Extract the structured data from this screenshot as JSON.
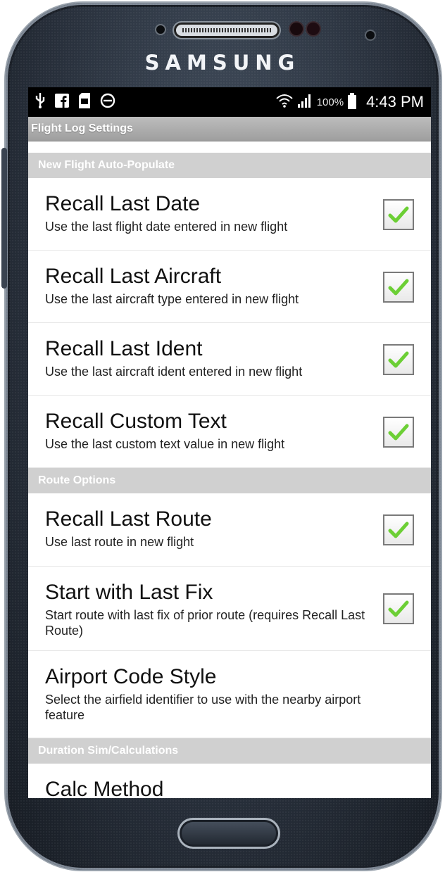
{
  "device": {
    "brand": "SAMSUNG"
  },
  "statusbar": {
    "left_icons": [
      "usb-icon",
      "facebook-icon",
      "sd-card-icon",
      "do-not-disturb-icon"
    ],
    "battery_percent": "100%",
    "time": "4:43 PM"
  },
  "app": {
    "title": "Flight Log Settings"
  },
  "sections": [
    {
      "header": "New Flight Auto-Populate",
      "items": [
        {
          "title": "Recall Last Date",
          "summary": "Use the last flight date entered in new flight",
          "checked": true
        },
        {
          "title": "Recall Last Aircraft",
          "summary": "Use the last aircraft type entered in new flight",
          "checked": true
        },
        {
          "title": "Recall Last Ident",
          "summary": "Use the last aircraft ident entered in new flight",
          "checked": true
        },
        {
          "title": "Recall Custom Text",
          "summary": "Use the last custom text value in new flight",
          "checked": true
        }
      ]
    },
    {
      "header": "Route Options",
      "items": [
        {
          "title": "Recall Last Route",
          "summary": "Use last route in new flight",
          "checked": true
        },
        {
          "title": "Start with Last Fix",
          "summary": "Start route with last fix of prior route (requires Recall Last Route)",
          "checked": true
        },
        {
          "title": "Airport Code Style",
          "summary": "Select the airfield identifier to use with the nearby airport feature"
        }
      ]
    },
    {
      "header": "Duration Sim/Calculations",
      "items": [
        {
          "title": "Calc Method"
        }
      ]
    }
  ],
  "colors": {
    "check": "#6ccf35",
    "section_bg": "#d0d0d0",
    "titlebar_bg": "#a8a8a8"
  }
}
